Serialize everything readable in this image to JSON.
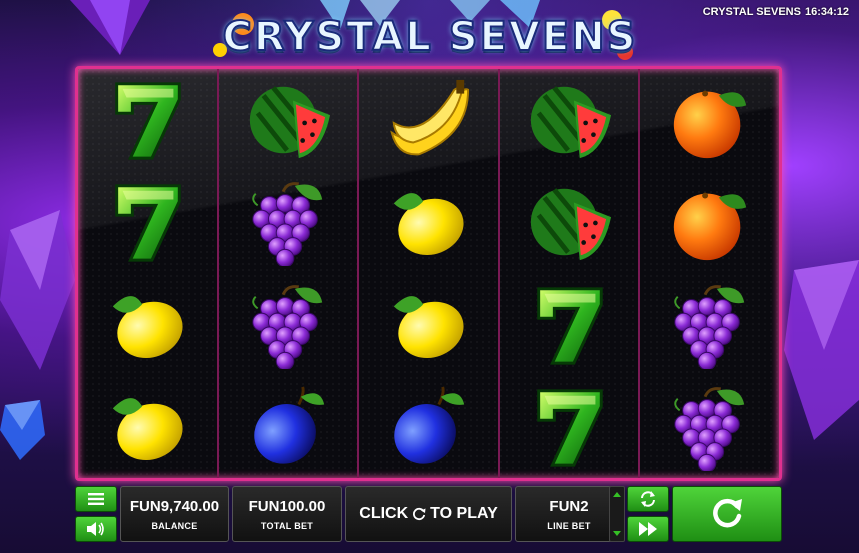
{
  "header": {
    "clock": {
      "game_name": "CRYSTAL SEVENS",
      "time": "16:34:12"
    },
    "logo_text": "CRYSTAL SEVENS"
  },
  "reels": [
    [
      "seven",
      "seven",
      "lemon",
      "lemon"
    ],
    [
      "watermelon",
      "grapes",
      "grapes",
      "plum"
    ],
    [
      "banana",
      "lemon",
      "lemon",
      "plum"
    ],
    [
      "watermelon",
      "watermelon",
      "seven",
      "seven"
    ],
    [
      "orange",
      "orange",
      "grapes",
      "grapes"
    ]
  ],
  "controls": {
    "balance": {
      "value": "FUN9,740.00",
      "label": "BALANCE"
    },
    "total_bet": {
      "value": "FUN100.00",
      "label": "TOTAL BET"
    },
    "play_prompt": {
      "before": "CLICK",
      "after": "TO PLAY"
    },
    "line_bet": {
      "value": "FUN2",
      "label": "LINE BET"
    }
  },
  "icons": {
    "menu": "menu-icon",
    "sound": "speaker-icon",
    "autoplay": "autoplay-icon",
    "turbo": "fast-forward-icon",
    "spin": "spin-icon"
  },
  "colors": {
    "frame_border": "#e0308f",
    "button_green": "#3cc02a"
  }
}
